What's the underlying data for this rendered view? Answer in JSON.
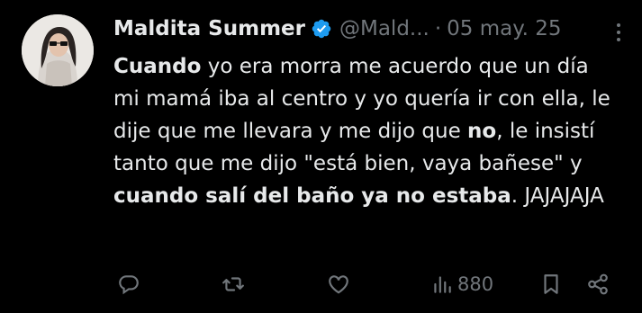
{
  "author": {
    "name": "Maldita Summer",
    "handle": "@Mald...",
    "separator": "·",
    "date": "05 may. 25"
  },
  "tweet": {
    "segments": [
      {
        "text": "Cuando",
        "bold": true
      },
      {
        "text": " yo era morra me acuerdo que un día mi mamá iba al centro y yo quería ir con ella, le dije que me llevara y me dijo que ",
        "bold": false
      },
      {
        "text": "no",
        "bold": true
      },
      {
        "text": ", le insistí tanto que me dijo \"está bien, vaya bañese\" y ",
        "bold": false
      },
      {
        "text": "cuando salí del baño ya no estaba",
        "bold": true
      },
      {
        "text": ". JAJAJAJA",
        "bold": false
      }
    ]
  },
  "actions": {
    "views": "880"
  },
  "colors": {
    "background": "#000000",
    "text": "#e7e9ea",
    "muted": "#71767b",
    "verified": "#1d9bf0"
  },
  "icons": [
    "verified-badge-icon",
    "more-icon",
    "reply-icon",
    "retweet-icon",
    "like-icon",
    "views-icon",
    "bookmark-icon",
    "share-icon"
  ]
}
